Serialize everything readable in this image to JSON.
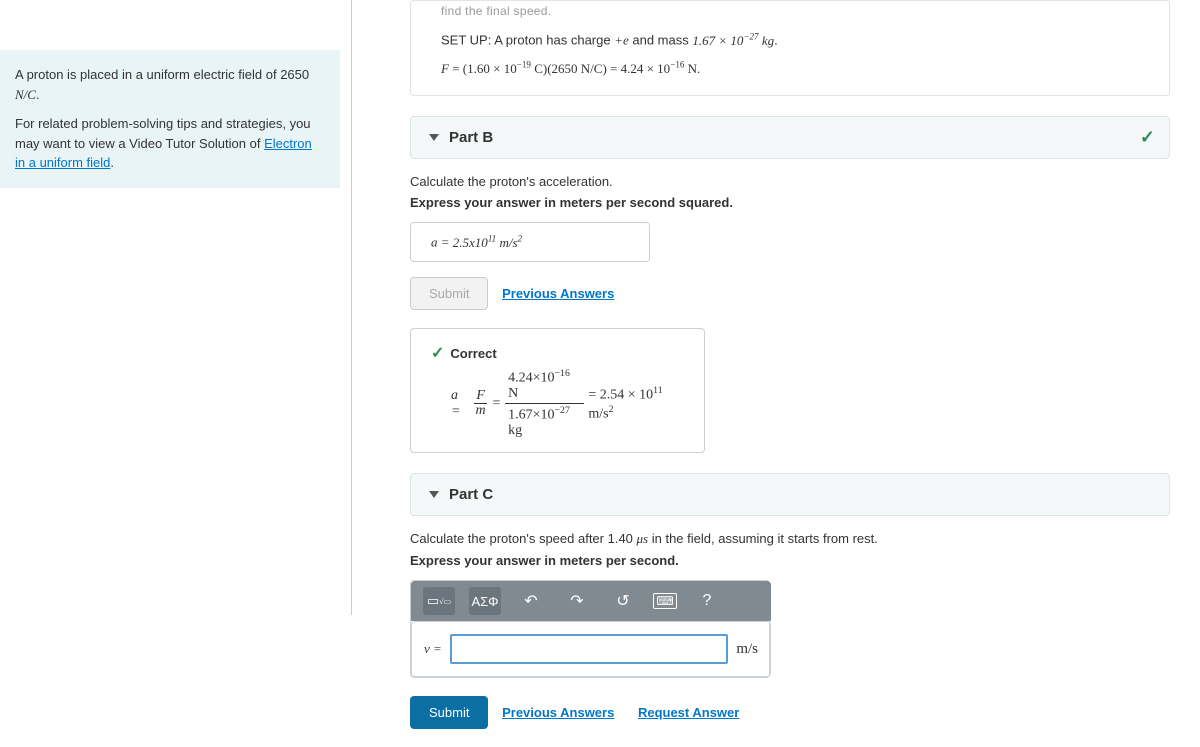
{
  "sidebar": {
    "line1_a": "A proton is placed in a uniform electric field of 2650 ",
    "line1_unit": "N/C",
    "line1_b": ".",
    "line2_a": "For related problem-solving tips and strategies, you may want to view a Video Tutor Solution of ",
    "line2_link": "Electron in a uniform field",
    "line2_b": "."
  },
  "solution": {
    "truncated": "find the final speed.",
    "setup_a": "SET UP: A proton has charge ",
    "setup_b": " and mass ",
    "mass": "1.67 × 10",
    "mass_exp": "−27",
    "mass_unit": " kg",
    "eq_lhs": "F = (1.60 × 10",
    "eq_exp1": "−19",
    "eq_mid": " C)(2650 N/C) = 4.24 × 10",
    "eq_exp2": "−16",
    "eq_unit": " N."
  },
  "partB": {
    "title": "Part B",
    "q": "Calculate the proton's acceleration.",
    "instr": "Express your answer in meters per second squared.",
    "lhs": "a = ",
    "val": "2.5x10",
    "val_exp": "11",
    "unit": "  m/s",
    "submit": "Submit",
    "prev": "Previous Answers",
    "correct_label": "Correct",
    "work_num": "4.24×10",
    "work_num_exp": "−16",
    "work_num_unit": " N",
    "work_den": "1.67×10",
    "work_den_exp": "−27",
    "work_den_unit": " kg",
    "work_res": "= 2.54 × 10",
    "work_res_exp": "11",
    "work_res_unit": " m/s"
  },
  "partC": {
    "title": "Part C",
    "q_a": "Calculate the proton's speed after 1.40 ",
    "q_unit": "μs",
    "q_b": " in the field, assuming it starts from rest.",
    "instr": "Express your answer in meters per second.",
    "lhs": "v = ",
    "unit": "m/s",
    "submit": "Submit",
    "prev": "Previous Answers",
    "req": "Request Answer",
    "tool_greek": "ΑΣΦ",
    "tool_help": "?"
  }
}
